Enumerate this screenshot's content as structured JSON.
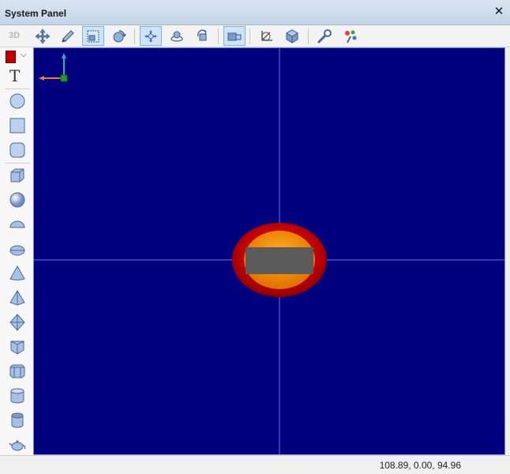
{
  "window": {
    "title": "System Panel",
    "close_glyph": "✕"
  },
  "toolbar": {
    "mode_label": "3D",
    "buttons": [
      {
        "icon": "move-arrows-icon"
      },
      {
        "icon": "pencil-icon"
      },
      {
        "icon": "select-rect-icon",
        "active": true
      },
      {
        "icon": "rotate-sphere-icon"
      },
      {
        "icon": "pan-icon",
        "active": true
      },
      {
        "icon": "orbit-icon"
      },
      {
        "icon": "rotate-view-icon"
      },
      {
        "icon": "box-view-icon",
        "active": true
      },
      {
        "icon": "axes-icon"
      },
      {
        "icon": "cube-shade-icon"
      },
      {
        "icon": "wrench-icon"
      },
      {
        "icon": "settings-tools-icon"
      }
    ]
  },
  "sidebar": {
    "color": "#c00000",
    "text_tool": "T",
    "tools": [
      "circle",
      "square",
      "rounded-square",
      "cube",
      "sphere",
      "hemisphere",
      "half-disc",
      "cone",
      "pyramid",
      "octahedron",
      "prism",
      "hex-cylinder",
      "cylinder",
      "tube",
      "teapot"
    ]
  },
  "viewport": {
    "background": "#00007f",
    "grid_color": "#6f74d8"
  },
  "status": {
    "coords": "108.89, 0.00, 94.96"
  }
}
